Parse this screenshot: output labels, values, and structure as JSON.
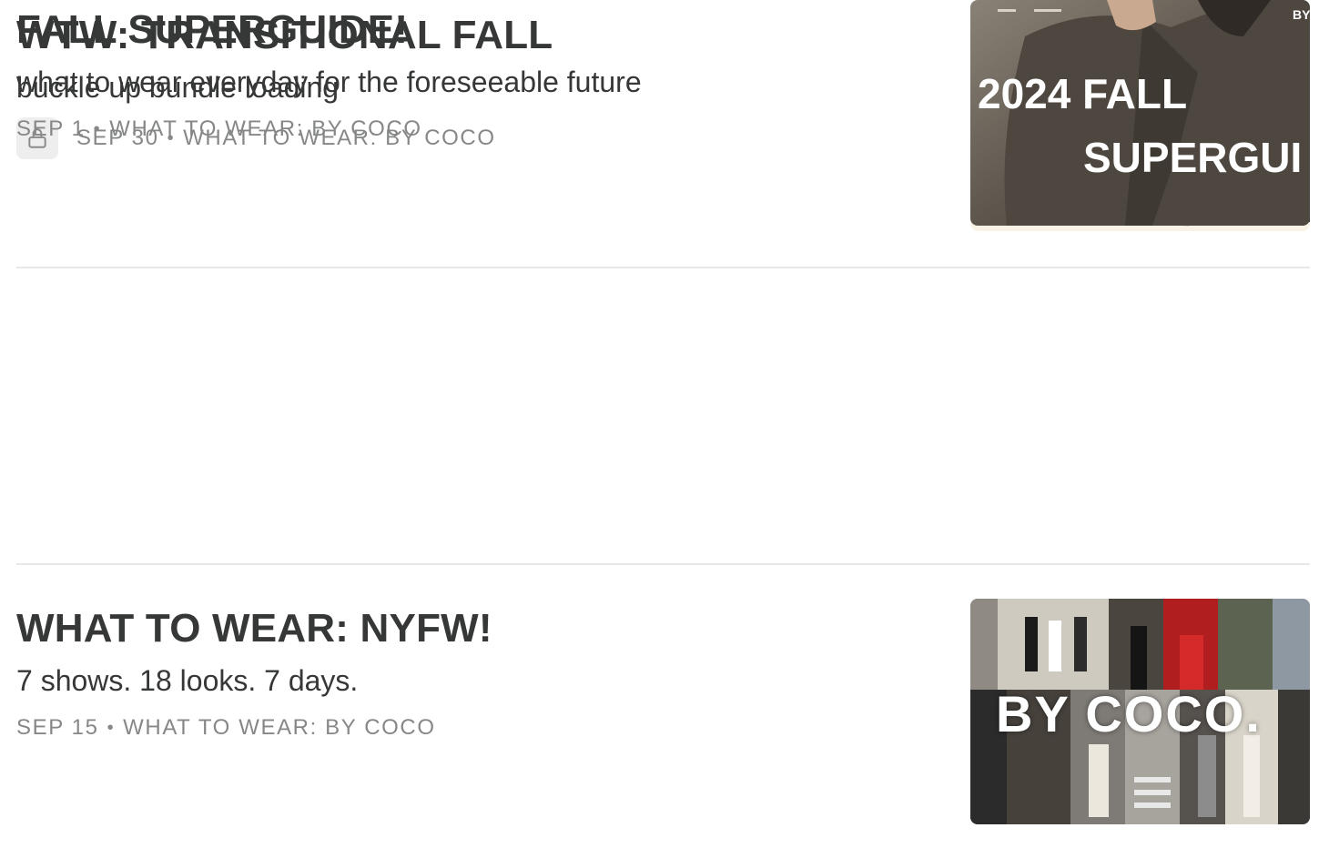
{
  "posts": [
    {
      "title": "WTW: TRANSITIONAL FALL",
      "subtitle": "buckle up bundle loading",
      "date": "SEP 30",
      "publication": "WHAT TO WEAR: BY COCO",
      "locked": true,
      "lock_icon": "lock-icon"
    },
    {
      "title": "WHAT TO WEAR: NYFW!",
      "subtitle": "7 shows. 18 looks. 7 days.",
      "date": "SEP 15",
      "publication": "WHAT TO WEAR: BY COCO",
      "locked": false,
      "thumb_text": "BY COCO."
    },
    {
      "title": "FALL SUPERGUIDE!",
      "subtitle": "what to wear everyday for the foreseeable future",
      "date": "SEP 1",
      "publication": "WHAT TO WEAR: BY COCO",
      "locked": false,
      "thumb_text_line1": "2024 FALL",
      "thumb_text_line2": "SUPERGUI",
      "thumb_corner": "BY"
    }
  ],
  "meta_separator": "•",
  "colors": {
    "title": "#363737",
    "meta": "#868787",
    "divider": "#e8e8e8",
    "lock_badge_bg": "#eeeeee"
  }
}
